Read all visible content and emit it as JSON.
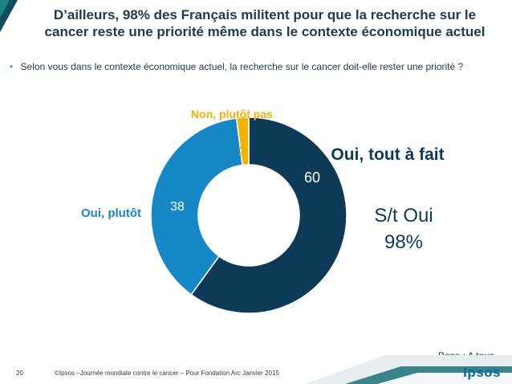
{
  "slide": {
    "title": "D’ailleurs, 98% des Français militent pour que la recherche sur le cancer reste une priorité même dans le contexte économique actuel",
    "question": "Selon vous dans le contexte économique actuel, la recherche sur le cancer doit-elle rester une priorité ?",
    "base_note": "Base : A tous",
    "page_number": "20",
    "credit": "©Ipsos –Journée mondiale contre le cancer – Pour Fondation Arc  Janvier 2015",
    "logo_text": "Ipsos"
  },
  "chart_data": {
    "type": "pie",
    "donut": true,
    "slices": [
      {
        "label": "Oui, tout à fait",
        "value": 60,
        "color": "#0d3b57"
      },
      {
        "label": "Oui, plutôt",
        "value": 38,
        "color": "#1688c7"
      },
      {
        "label": "Non, plutôt pas",
        "value": 2,
        "color": "#f2b300"
      }
    ],
    "summary_label": "S/t Oui",
    "summary_value": "98%"
  },
  "colors": {
    "title": "#1f3a4d",
    "dark_label": "#0d3b57",
    "mid_label": "#1688c7",
    "yellow_label": "#f2b300"
  }
}
